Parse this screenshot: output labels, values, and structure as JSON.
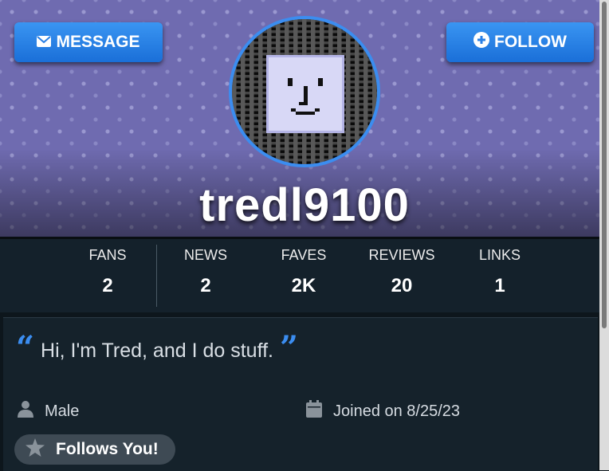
{
  "header": {
    "message_label": "MESSAGE",
    "follow_label": "FOLLOW",
    "username": "tredl9100",
    "accent_color": "#2f86ec"
  },
  "stats": [
    {
      "label": "FANS",
      "value": "2"
    },
    {
      "label": "NEWS",
      "value": "2"
    },
    {
      "label": "FAVES",
      "value": "2K"
    },
    {
      "label": "REVIEWS",
      "value": "20"
    },
    {
      "label": "LINKS",
      "value": "1"
    }
  ],
  "bio": {
    "quote": "Hi, I'm Tred, and I do stuff.",
    "gender": "Male",
    "joined": "Joined on 8/25/23",
    "follows_badge": "Follows You!"
  },
  "icons": {
    "message": "envelope-icon",
    "follow": "plus-circle-icon",
    "gender": "person-icon",
    "joined": "calendar-icon",
    "badge": "star-icon"
  }
}
